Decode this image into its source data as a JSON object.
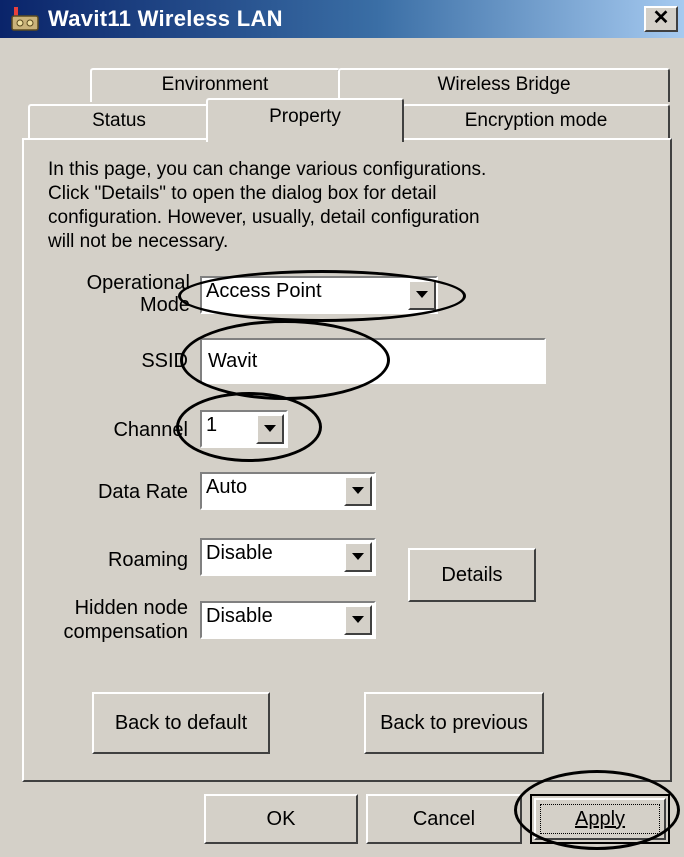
{
  "window": {
    "title": "Wavit11 Wireless LAN",
    "close_icon": "close-icon",
    "app_icon": "wireless-lan-icon"
  },
  "tabs": {
    "row_back": [
      {
        "label": "Environment"
      },
      {
        "label": "Wireless Bridge"
      }
    ],
    "row_front": [
      {
        "label": "Status"
      },
      {
        "label": "Property",
        "selected": true
      },
      {
        "label": "Encryption mode"
      }
    ]
  },
  "property": {
    "intro_lines": [
      "In this page, you can change various configurations.",
      "Click \"Details\" to open the dialog box for detail",
      "configuration. However, usually, detail configuration",
      "will not be necessary."
    ],
    "operational_mode": {
      "label_line1": "Operational",
      "label_line2": "Mode",
      "value": "Access Point"
    },
    "ssid": {
      "label": "SSID",
      "value": "Wavit"
    },
    "channel": {
      "label": "Channel",
      "value": "1"
    },
    "data_rate": {
      "label": "Data Rate",
      "value": "Auto"
    },
    "roaming": {
      "label": "Roaming",
      "value": "Disable"
    },
    "hidden_node": {
      "label_line1": "Hidden node",
      "label_line2": "compensation",
      "value": "Disable"
    },
    "details_button": "Details",
    "back_default_button": "Back to default",
    "back_previous_button": "Back to previous"
  },
  "footer": {
    "ok_button": "OK",
    "cancel_button": "Cancel",
    "apply_button": "Apply"
  },
  "colors": {
    "face": "#d4d0c8",
    "title_start": "#0a246a",
    "title_end": "#a6caf0"
  }
}
